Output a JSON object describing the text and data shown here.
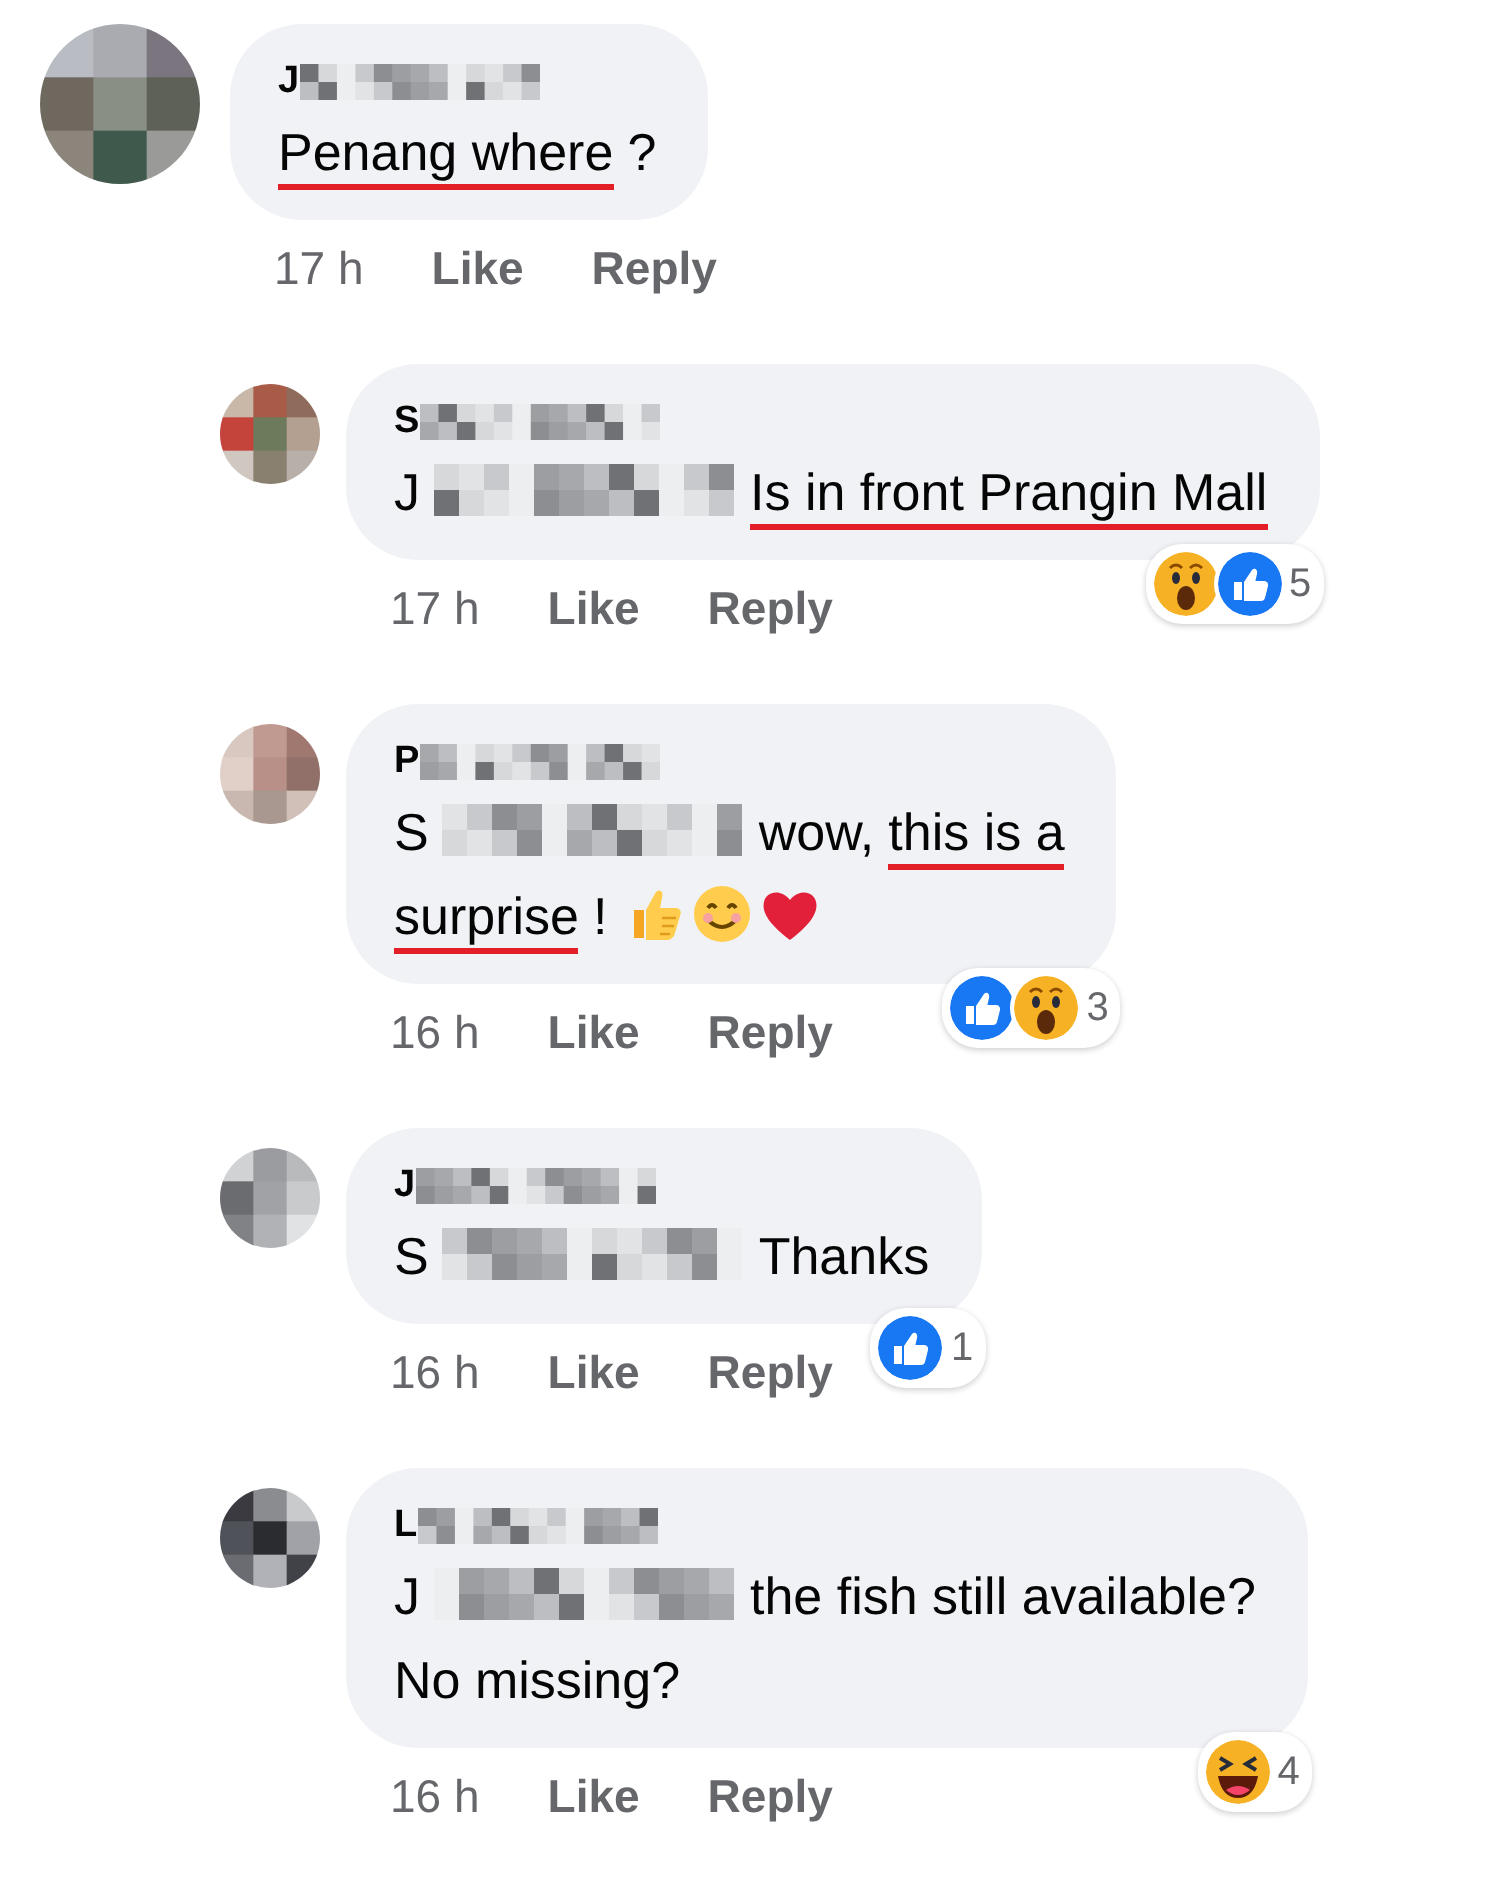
{
  "comments": [
    {
      "author": [
        {
          "kind": "text",
          "text": "J"
        },
        {
          "kind": "redacted"
        }
      ],
      "lines": [
        [
          {
            "kind": "text",
            "text": "Penang where",
            "spellcheck": true
          },
          {
            "kind": "text",
            "text": "?",
            "spellcheck": false
          }
        ]
      ],
      "time": "17 h",
      "actions": [
        "Like",
        "Reply"
      ],
      "replies": [
        {
          "author": [
            {
              "kind": "text",
              "text": "S"
            },
            {
              "kind": "redacted"
            }
          ],
          "lines": [
            [
              {
                "kind": "text",
                "text": "J",
                "spellcheck": false
              },
              {
                "kind": "redacted"
              },
              {
                "kind": "text",
                "text": "Is in front Prangin Mall",
                "spellcheck": true
              }
            ]
          ],
          "time": "17 h",
          "actions": [
            "Like",
            "Reply"
          ],
          "reactions": [
            {
              "kind": "wow"
            },
            {
              "kind": "like"
            }
          ],
          "reaction_count": "5"
        },
        {
          "author": [
            {
              "kind": "text",
              "text": "P"
            },
            {
              "kind": "redacted"
            }
          ],
          "lines": [
            [
              {
                "kind": "text",
                "text": "S",
                "spellcheck": false
              },
              {
                "kind": "redacted"
              },
              {
                "kind": "text",
                "text": "wow,",
                "spellcheck": false
              },
              {
                "kind": "text",
                "text": "this is a",
                "spellcheck": true
              }
            ],
            [
              {
                "kind": "text",
                "text": "surprise",
                "spellcheck": true
              },
              {
                "kind": "text",
                "text": "!",
                "spellcheck": false
              },
              {
                "kind": "thumbs"
              },
              {
                "kind": "smile"
              },
              {
                "kind": "heart"
              }
            ]
          ],
          "time": "16 h",
          "actions": [
            "Like",
            "Reply"
          ],
          "reactions": [
            {
              "kind": "like"
            },
            {
              "kind": "wow"
            }
          ],
          "reaction_count": "3"
        },
        {
          "author": [
            {
              "kind": "text",
              "text": "J"
            },
            {
              "kind": "redacted"
            }
          ],
          "lines": [
            [
              {
                "kind": "text",
                "text": "S",
                "spellcheck": false
              },
              {
                "kind": "redacted"
              },
              {
                "kind": "text",
                "text": "Thanks",
                "spellcheck": false
              }
            ]
          ],
          "time": "16 h",
          "actions": [
            "Like",
            "Reply"
          ],
          "reactions": [
            {
              "kind": "like"
            }
          ],
          "reaction_count": "1"
        },
        {
          "author": [
            {
              "kind": "text",
              "text": "L"
            },
            {
              "kind": "redacted"
            }
          ],
          "lines": [
            [
              {
                "kind": "text",
                "text": "J",
                "spellcheck": false
              },
              {
                "kind": "redacted"
              },
              {
                "kind": "text",
                "text": "the fish still available?",
                "spellcheck": false
              }
            ],
            [
              {
                "kind": "text",
                "text": "No missing?",
                "spellcheck": false
              }
            ]
          ],
          "time": "16 h",
          "actions": [
            "Like",
            "Reply"
          ],
          "reactions": [
            {
              "kind": "haha"
            }
          ],
          "reaction_count": "4"
        }
      ]
    }
  ]
}
